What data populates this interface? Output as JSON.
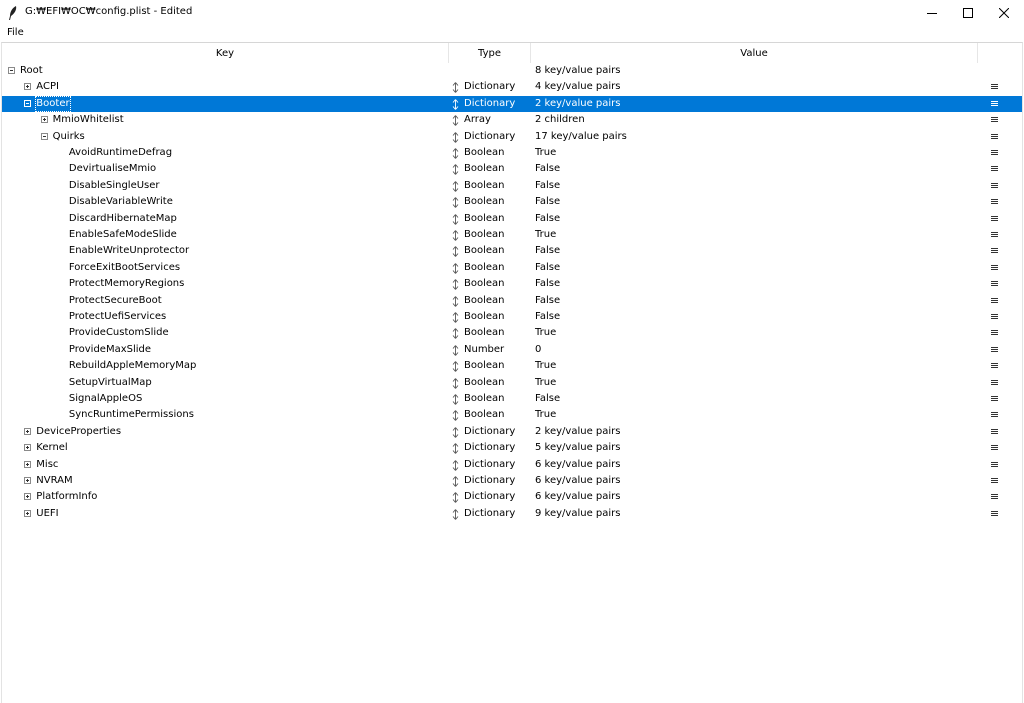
{
  "window": {
    "title": "G:₩EFI₩OC₩config.plist - Edited",
    "icons": {
      "app": "feather-icon",
      "minimize": "minimize-icon",
      "maximize": "maximize-icon",
      "close": "close-icon"
    }
  },
  "menubar": {
    "file": "File"
  },
  "columns": {
    "key": "Key",
    "type": "Type",
    "value": "Value"
  },
  "colors": {
    "selection": "#0078d7",
    "selection_text": "#ffffff"
  },
  "rows": [
    {
      "key": "Root",
      "depth": 0,
      "toggle": "collapse",
      "type": "",
      "value": "8 key/value pairs",
      "menu": false,
      "selected": false
    },
    {
      "key": "ACPI",
      "depth": 1,
      "toggle": "expand",
      "type": "Dictionary",
      "value": "4 key/value pairs",
      "menu": true,
      "selected": false
    },
    {
      "key": "Booter",
      "depth": 1,
      "toggle": "collapse",
      "type": "Dictionary",
      "value": "2 key/value pairs",
      "menu": true,
      "selected": true
    },
    {
      "key": "MmioWhitelist",
      "depth": 2,
      "toggle": "expand",
      "type": "Array",
      "value": "2 children",
      "menu": true,
      "selected": false
    },
    {
      "key": "Quirks",
      "depth": 2,
      "toggle": "collapse",
      "type": "Dictionary",
      "value": "17 key/value pairs",
      "menu": true,
      "selected": false
    },
    {
      "key": "AvoidRuntimeDefrag",
      "depth": 3,
      "toggle": "none",
      "type": "Boolean",
      "value": "True",
      "menu": true,
      "selected": false
    },
    {
      "key": "DevirtualiseMmio",
      "depth": 3,
      "toggle": "none",
      "type": "Boolean",
      "value": "False",
      "menu": true,
      "selected": false
    },
    {
      "key": "DisableSingleUser",
      "depth": 3,
      "toggle": "none",
      "type": "Boolean",
      "value": "False",
      "menu": true,
      "selected": false
    },
    {
      "key": "DisableVariableWrite",
      "depth": 3,
      "toggle": "none",
      "type": "Boolean",
      "value": "False",
      "menu": true,
      "selected": false
    },
    {
      "key": "DiscardHibernateMap",
      "depth": 3,
      "toggle": "none",
      "type": "Boolean",
      "value": "False",
      "menu": true,
      "selected": false
    },
    {
      "key": "EnableSafeModeSlide",
      "depth": 3,
      "toggle": "none",
      "type": "Boolean",
      "value": "True",
      "menu": true,
      "selected": false
    },
    {
      "key": "EnableWriteUnprotector",
      "depth": 3,
      "toggle": "none",
      "type": "Boolean",
      "value": "False",
      "menu": true,
      "selected": false
    },
    {
      "key": "ForceExitBootServices",
      "depth": 3,
      "toggle": "none",
      "type": "Boolean",
      "value": "False",
      "menu": true,
      "selected": false
    },
    {
      "key": "ProtectMemoryRegions",
      "depth": 3,
      "toggle": "none",
      "type": "Boolean",
      "value": "False",
      "menu": true,
      "selected": false
    },
    {
      "key": "ProtectSecureBoot",
      "depth": 3,
      "toggle": "none",
      "type": "Boolean",
      "value": "False",
      "menu": true,
      "selected": false
    },
    {
      "key": "ProtectUefiServices",
      "depth": 3,
      "toggle": "none",
      "type": "Boolean",
      "value": "False",
      "menu": true,
      "selected": false
    },
    {
      "key": "ProvideCustomSlide",
      "depth": 3,
      "toggle": "none",
      "type": "Boolean",
      "value": "True",
      "menu": true,
      "selected": false
    },
    {
      "key": "ProvideMaxSlide",
      "depth": 3,
      "toggle": "none",
      "type": "Number",
      "value": "0",
      "menu": true,
      "selected": false
    },
    {
      "key": "RebuildAppleMemoryMap",
      "depth": 3,
      "toggle": "none",
      "type": "Boolean",
      "value": "True",
      "menu": true,
      "selected": false
    },
    {
      "key": "SetupVirtualMap",
      "depth": 3,
      "toggle": "none",
      "type": "Boolean",
      "value": "True",
      "menu": true,
      "selected": false
    },
    {
      "key": "SignalAppleOS",
      "depth": 3,
      "toggle": "none",
      "type": "Boolean",
      "value": "False",
      "menu": true,
      "selected": false
    },
    {
      "key": "SyncRuntimePermissions",
      "depth": 3,
      "toggle": "none",
      "type": "Boolean",
      "value": "True",
      "menu": true,
      "selected": false
    },
    {
      "key": "DeviceProperties",
      "depth": 1,
      "toggle": "expand",
      "type": "Dictionary",
      "value": "2 key/value pairs",
      "menu": true,
      "selected": false
    },
    {
      "key": "Kernel",
      "depth": 1,
      "toggle": "expand",
      "type": "Dictionary",
      "value": "5 key/value pairs",
      "menu": true,
      "selected": false
    },
    {
      "key": "Misc",
      "depth": 1,
      "toggle": "expand",
      "type": "Dictionary",
      "value": "6 key/value pairs",
      "menu": true,
      "selected": false
    },
    {
      "key": "NVRAM",
      "depth": 1,
      "toggle": "expand",
      "type": "Dictionary",
      "value": "6 key/value pairs",
      "menu": true,
      "selected": false
    },
    {
      "key": "PlatformInfo",
      "depth": 1,
      "toggle": "expand",
      "type": "Dictionary",
      "value": "6 key/value pairs",
      "menu": true,
      "selected": false
    },
    {
      "key": "UEFI",
      "depth": 1,
      "toggle": "expand",
      "type": "Dictionary",
      "value": "9 key/value pairs",
      "menu": true,
      "selected": false
    }
  ]
}
